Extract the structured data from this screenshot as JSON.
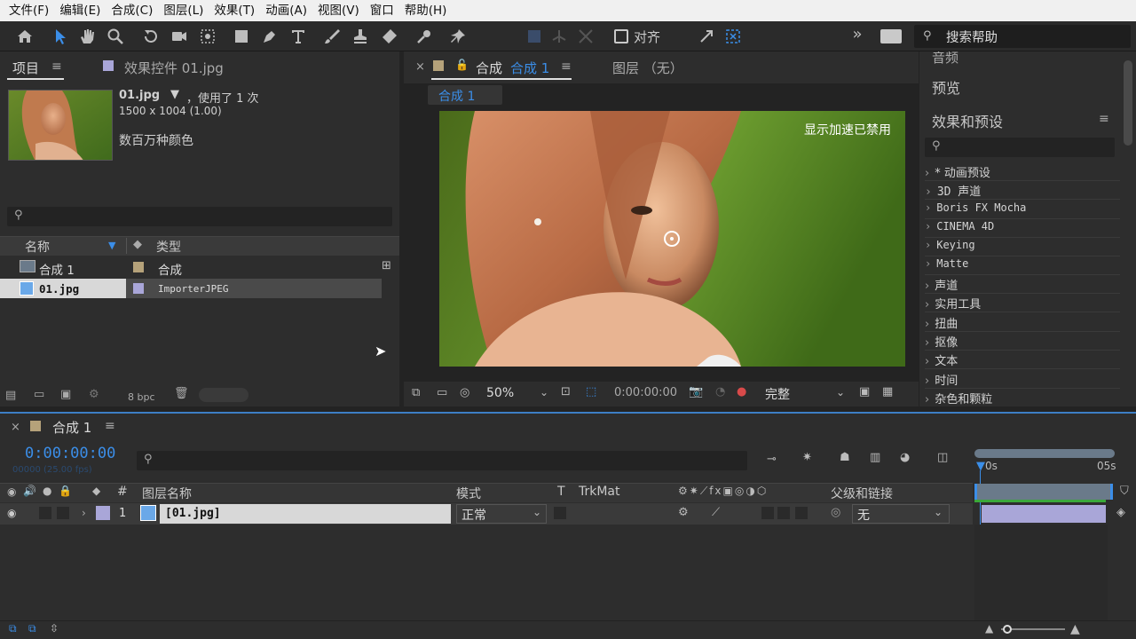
{
  "menu": [
    "文件(F)",
    "编辑(E)",
    "合成(C)",
    "图层(L)",
    "效果(T)",
    "动画(A)",
    "视图(V)",
    "窗口",
    "帮助(H)"
  ],
  "toolbar": {
    "tools": [
      "home-icon",
      "selection-icon",
      "hand-icon",
      "zoom-icon",
      "rotate-icon",
      "camera-icon",
      "pan-behind-icon",
      "rectangle-icon",
      "pen-icon",
      "type-icon",
      "brush-icon",
      "clone-stamp-icon",
      "eraser-icon",
      "roto-brush-icon",
      "puppet-pin-icon"
    ],
    "snap_label": "对齐",
    "search_help": "搜索帮助",
    "more": "»"
  },
  "project_panel": {
    "tab_project": "项目",
    "tab_effects": "效果控件 01.jpg",
    "file_name": "01.jpg",
    "used": "，使用了 1 次",
    "dimensions": "1500 x 1004 (1.00)",
    "colors": "数百万种颜色",
    "col_name": "名称",
    "col_type": "类型",
    "items": [
      {
        "name": "合成 1",
        "type": "合成",
        "color": "#b5a27a"
      },
      {
        "name": "01.jpg",
        "type": "ImporterJPEG",
        "color": "#a9a6d8"
      }
    ],
    "bpc": "8 bpc"
  },
  "comp_viewer": {
    "tab_label": "合成",
    "tab_comp": "合成 1",
    "tab_layer": "图层 （无）",
    "breadcrumb": "合成 1",
    "notice": "显示加速已禁用",
    "zoom": "50%",
    "timecode": "0:00:00:00",
    "quality": "完整"
  },
  "right_panel": {
    "audio": "音频",
    "preview": "预览",
    "effects_title": "效果和预设",
    "effects": [
      "* 动画预设",
      "3D 声道",
      "Boris FX Mocha",
      "CINEMA 4D",
      "Keying",
      "Matte",
      "声道",
      "实用工具",
      "扭曲",
      "抠像",
      "文本",
      "时间",
      "杂色和颗粒"
    ]
  },
  "timeline": {
    "comp_name": "合成 1",
    "timecode": "0:00:00:00",
    "sub_timecode": "00000 (25.00 fps)",
    "col_hash": "#",
    "col_layer_name": "图层名称",
    "col_mode": "模式",
    "col_t": "T",
    "col_trkmat": "TrkMat",
    "col_parent": "父级和链接",
    "ruler_start": "0s",
    "ruler_end": "05s",
    "layer": {
      "index": "1",
      "name": "[01.jpg]",
      "mode": "正常",
      "parent": "无",
      "color": "#a9a6d8"
    }
  },
  "colors": {
    "accent": "#3b8ee8",
    "comp_swatch": "#b5a27a",
    "jpg_swatch": "#a9a6d8"
  }
}
